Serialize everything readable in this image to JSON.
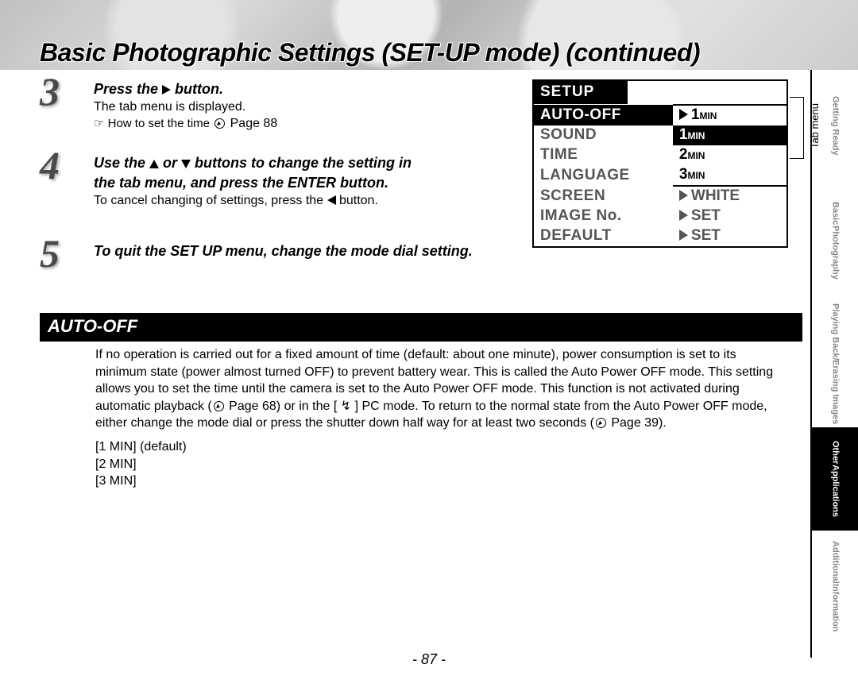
{
  "title": "Basic Photographic Settings (SET-UP mode) (continued)",
  "steps": {
    "s3": {
      "num": "3",
      "bold_pre": "Press the ",
      "bold_post": " button.",
      "line1": "The tab menu is displayed.",
      "line2_pre": "☞ How to set the time ",
      "line2_post": " Page 88"
    },
    "s4": {
      "num": "4",
      "bold_line1_pre": "Use the ",
      "bold_line1_mid": " or ",
      "bold_line1_post": " buttons to change the setting in",
      "bold_line2": "the tab menu, and press the ENTER button.",
      "sub_pre": "To cancel changing of settings, press the ",
      "sub_post": " button."
    },
    "s5": {
      "num": "5",
      "bold": "To quit the SET UP menu, change the mode dial setting."
    }
  },
  "lcd": {
    "title": "SETUP",
    "rows": {
      "autoOff": {
        "k": "AUTO-OFF",
        "v_num": "1",
        "v_unit": "MIN"
      },
      "sound": {
        "k": "SOUND",
        "v_num": "1",
        "v_unit": "MIN"
      },
      "time": {
        "k": "TIME",
        "v_num": "2",
        "v_unit": "MIN"
      },
      "language": {
        "k": "LANGUAGE",
        "v_num": "3",
        "v_unit": "MIN"
      },
      "screen": {
        "k": "SCREEN",
        "v": "WHITE"
      },
      "imageNo": {
        "k": "IMAGE  No.",
        "v": "SET"
      },
      "default": {
        "k": "DEFAULT",
        "v": "SET"
      }
    },
    "bracket_label": "Tab menu"
  },
  "section": {
    "bar": "AUTO-OFF",
    "para_a": "If no operation is carried out for a fixed amount of time (default: about one minute), power consumption is set to its minimum state (power almost turned OFF) to prevent battery wear. This is called the Auto Power OFF mode. This setting allows you to set the time until the camera is set to the Auto Power OFF mode. This function is not activated during automatic playback (",
    "para_b": " Page 68) or in the [ ",
    "para_c": " ] PC mode. To return to the normal state from the Auto Power OFF mode, either change the mode dial or press the shutter down half way for at least two seconds (",
    "para_d": " Page 39).",
    "pc_icon": "↯",
    "opt1": "[1 MIN] (default)",
    "opt2": "[2 MIN]",
    "opt3": "[3 MIN]"
  },
  "nav": {
    "gr": "Getting Ready",
    "bp1": "Basic",
    "bp2": "Photography",
    "pbe1": "Playing Back/",
    "pbe2": "Erasing Images",
    "oa1": "Other",
    "oa2": "Applications",
    "ai1": "Additional",
    "ai2": "Information"
  },
  "page_number": "- 87 -"
}
